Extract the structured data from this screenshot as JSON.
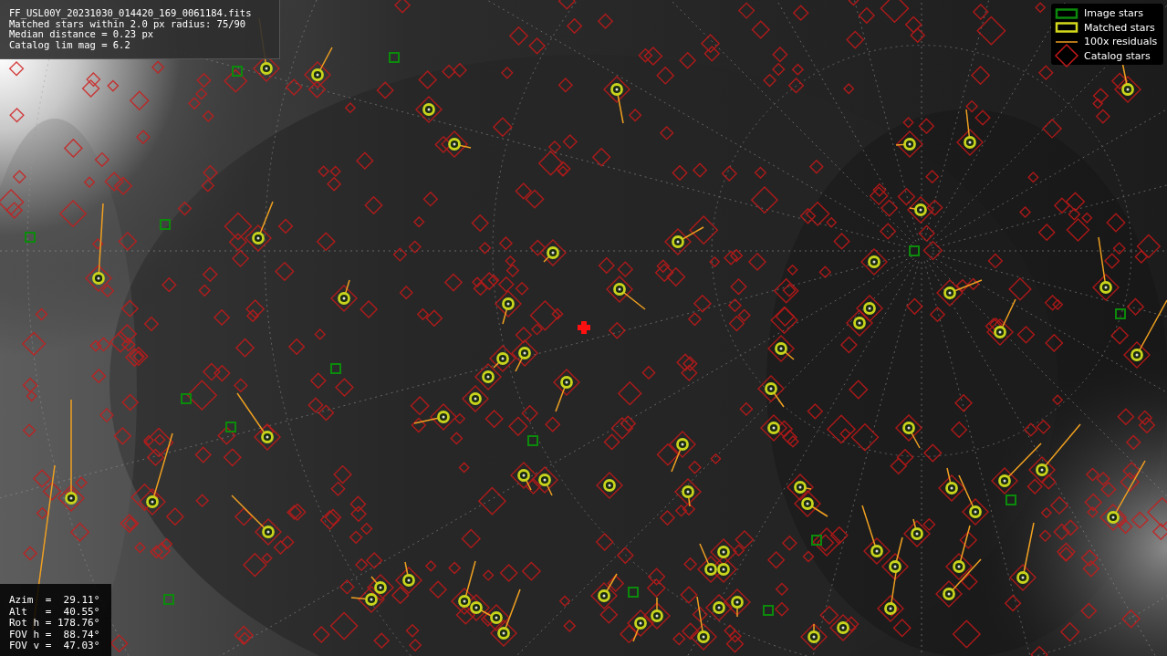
{
  "info_panel": {
    "lines": [
      "FF_USL00Y_20231030_014420_169_0061184.fits",
      "Matched stars within 2.0 px radius: 75/90",
      "Median distance = 0.23 px",
      "Catalog lim mag = 6.2"
    ]
  },
  "legend": {
    "items": [
      {
        "label": "Image stars"
      },
      {
        "kind": "matched",
        "label": "Matched stars"
      },
      {
        "kind": "residual",
        "label": "100x residuals"
      },
      {
        "kind": "catalog",
        "label": "Catalog stars"
      }
    ]
  },
  "pointing_panel": {
    "lines": [
      "Azim  =  29.11°",
      "Alt   =  40.55°",
      "Rot h = 178.76°",
      "FOV h =  88.74°",
      "FOV v =  47.03°"
    ]
  }
}
